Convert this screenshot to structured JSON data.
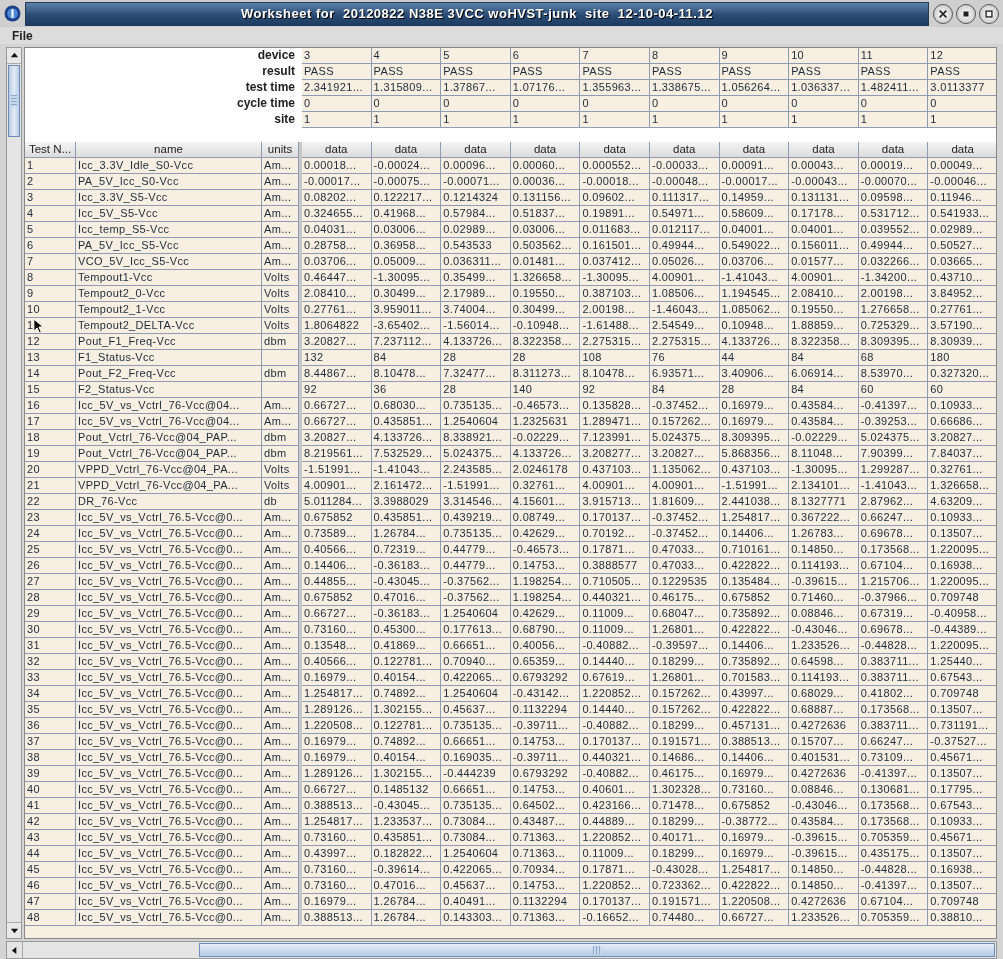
{
  "window": {
    "title": "Worksheet for  20120822 N38E 3VCC woHVST-junk  site  12-10-04-11.12"
  },
  "menu": [
    "File"
  ],
  "summary": {
    "rows": [
      {
        "label": "device",
        "values": [
          "3",
          "4",
          "5",
          "6",
          "7",
          "8",
          "9",
          "10",
          "11",
          "12"
        ]
      },
      {
        "label": "result",
        "values": [
          "PASS",
          "PASS",
          "PASS",
          "PASS",
          "PASS",
          "PASS",
          "PASS",
          "PASS",
          "PASS",
          "PASS"
        ]
      },
      {
        "label": "test time",
        "values": [
          "2.341921...",
          "1.315809...",
          "1.37867...",
          "1.07176...",
          "1.355963...",
          "1.338675...",
          "1.056264...",
          "1.036337...",
          "1.482411...",
          "3.0113377"
        ]
      },
      {
        "label": "cycle time",
        "values": [
          "0",
          "0",
          "0",
          "0",
          "0",
          "0",
          "0",
          "0",
          "0",
          "0"
        ]
      },
      {
        "label": "site",
        "values": [
          "1",
          "1",
          "1",
          "1",
          "1",
          "1",
          "1",
          "1",
          "1",
          "1"
        ]
      }
    ]
  },
  "table": {
    "columns": [
      "Test N...",
      "name",
      "units"
    ],
    "data_columns": [
      "data",
      "data",
      "data",
      "data",
      "data",
      "data",
      "data",
      "data",
      "data",
      "data"
    ],
    "rows": [
      {
        "test": "1",
        "name": "Icc_3.3V_Idle_S0-Vcc",
        "units": "Am...",
        "values": [
          "0.00018...",
          "-0.00024...",
          "0.00096...",
          "0.00060...",
          "0.000552...",
          "-0.00033...",
          "0.00091...",
          "0.00043...",
          "0.00019...",
          "0.00049..."
        ]
      },
      {
        "test": "2",
        "name": "PA_5V_Icc_S0-Vcc",
        "units": "Am...",
        "values": [
          "-0.00017...",
          "-0.00075...",
          "-0.00071...",
          "0.00036...",
          "-0.00018...",
          "-0.00048...",
          "-0.00017...",
          "-0.00043...",
          "-0.00070...",
          "-0.00046..."
        ]
      },
      {
        "test": "3",
        "name": "Icc_3.3V_S5-Vcc",
        "units": "Am...",
        "values": [
          "0.08202...",
          "0.122217...",
          "0.1214324",
          "0.131156...",
          "0.09602...",
          "0.111317...",
          "0.14959...",
          "0.131131...",
          "0.09598...",
          "0.11946..."
        ]
      },
      {
        "test": "4",
        "name": "Icc_5V_S5-Vcc",
        "units": "Am...",
        "values": [
          "0.324655...",
          "0.41968...",
          "0.57984...",
          "0.51837...",
          "0.19891...",
          "0.54971...",
          "0.58609...",
          "0.17178...",
          "0.531712...",
          "0.541933..."
        ]
      },
      {
        "test": "5",
        "name": "Icc_temp_S5-Vcc",
        "units": "Am...",
        "values": [
          "0.04031...",
          "0.03006...",
          "0.02989...",
          "0.03006...",
          "0.011683...",
          "0.012117...",
          "0.04001...",
          "0.04001...",
          "0.039552...",
          "0.02989..."
        ]
      },
      {
        "test": "6",
        "name": "PA_5V_Icc_S5-Vcc",
        "units": "Am...",
        "values": [
          "0.28758...",
          "0.36958...",
          "0.543533",
          "0.503562...",
          "0.161501...",
          "0.49944...",
          "0.549022...",
          "0.156011...",
          "0.49944...",
          "0.50527..."
        ]
      },
      {
        "test": "7",
        "name": "VCO_5V_Icc_S5-Vcc",
        "units": "Am...",
        "values": [
          "0.03706...",
          "0.05009...",
          "0.036311...",
          "0.01481...",
          "0.037412...",
          "0.05026...",
          "0.03706...",
          "0.01577...",
          "0.032266...",
          "0.03665..."
        ]
      },
      {
        "test": "8",
        "name": "Tempout1-Vcc",
        "units": "Volts",
        "values": [
          "0.46447...",
          "-1.30095...",
          "0.35499...",
          "1.326658...",
          "-1.30095...",
          "4.00901...",
          "-1.41043...",
          "4.00901...",
          "-1.34200...",
          "0.43710..."
        ]
      },
      {
        "test": "9",
        "name": "Tempout2_0-Vcc",
        "units": "Volts",
        "values": [
          "2.08410...",
          "0.30499...",
          "2.17989...",
          "0.19550...",
          "0.387103...",
          "1.08506...",
          "1.194545...",
          "2.08410...",
          "2.00198...",
          "3.84952..."
        ]
      },
      {
        "test": "10",
        "name": "Tempout2_1-Vcc",
        "units": "Volts",
        "values": [
          "0.27761...",
          "3.959011...",
          "3.74004...",
          "0.30499...",
          "2.00198...",
          "-1.46043...",
          "1.085062...",
          "0.19550...",
          "1.276658...",
          "0.27761..."
        ]
      },
      {
        "test": "1",
        "name": "Tempout2_DELTA-Vcc",
        "units": "Volts",
        "values": [
          "1.8064822",
          "-3.65402...",
          "-1.56014...",
          "-0.10948...",
          "-1.61488...",
          "2.54549...",
          "0.10948...",
          "1.88859...",
          "0.725329...",
          "3.57190..."
        ]
      },
      {
        "test": "12",
        "name": "Pout_F1_Freq-Vcc",
        "units": "dbm",
        "values": [
          "3.20827...",
          "7.237112...",
          "4.133726...",
          "8.322358...",
          "2.275315...",
          "2.275315...",
          "4.133726...",
          "8.322358...",
          "8.309395...",
          "8.30939..."
        ]
      },
      {
        "test": "13",
        "name": "F1_Status-Vcc",
        "values": [
          "132",
          "84",
          "28",
          "28",
          "108",
          "76",
          "44",
          "84",
          "68",
          "180"
        ]
      },
      {
        "test": "14",
        "name": "Pout_F2_Freq-Vcc",
        "units": "dbm",
        "values": [
          "8.44867...",
          "8.10478...",
          "7.32477...",
          "8.311273...",
          "8.10478...",
          "6.93571...",
          "3.40906...",
          "6.06914...",
          "8.53970...",
          "0.327320..."
        ]
      },
      {
        "test": "15",
        "name": "F2_Status-Vcc",
        "values": [
          "92",
          "36",
          "28",
          "140",
          "92",
          "84",
          "28",
          "84",
          "60",
          "60"
        ]
      },
      {
        "test": "16",
        "name": "Icc_5V_vs_Vctrl_76-Vcc@04...",
        "units": "Am...",
        "values": [
          "0.66727...",
          "0.68030...",
          "0.735135...",
          "-0.46573...",
          "0.135828...",
          "-0.37452...",
          "0.16979...",
          "0.43584...",
          "-0.41397...",
          "0.10933..."
        ]
      },
      {
        "test": "17",
        "name": "Icc_5V_vs_Vctrl_76-Vcc@04...",
        "units": "Am...",
        "values": [
          "0.66727...",
          "0.435851...",
          "1.2540604",
          "1.2325631",
          "1.289471...",
          "0.157262...",
          "0.16979...",
          "0.43584...",
          "-0.39253...",
          "0.66686..."
        ]
      },
      {
        "test": "18",
        "name": "Pout_Vctrl_76-Vcc@04_PAP...",
        "units": "dbm",
        "values": [
          "3.20827...",
          "4.133726...",
          "8.338921...",
          "-0.02229...",
          "7.123991...",
          "5.024375...",
          "8.309395...",
          "-0.02229...",
          "5.024375...",
          "3.20827..."
        ]
      },
      {
        "test": "19",
        "name": "Pout_Vctrl_76-Vcc@04_PAP...",
        "units": "dbm",
        "values": [
          "8.219561...",
          "7.532529...",
          "5.024375...",
          "4.133726...",
          "3.208277...",
          "3.20827...",
          "5.868356...",
          "8.11048...",
          "7.90399...",
          "7.84037..."
        ]
      },
      {
        "test": "20",
        "name": "VPPD_Vctrl_76-Vcc@04_PA...",
        "units": "Volts",
        "values": [
          "-1.51991...",
          "-1.41043...",
          "2.243585...",
          "2.0246178",
          "0.437103...",
          "1.135062...",
          "0.437103...",
          "-1.30095...",
          "1.299287...",
          "0.32761..."
        ]
      },
      {
        "test": "21",
        "name": "VPPD_Vctrl_76-Vcc@04_PA...",
        "units": "Volts",
        "values": [
          "4.00901...",
          "2.161472...",
          "-1.51991...",
          "0.32761...",
          "4.00901...",
          "4.00901...",
          "-1.51991...",
          "2.134101...",
          "-1.41043...",
          "1.326658..."
        ]
      },
      {
        "test": "22",
        "name": "DR_76-Vcc",
        "units": "db",
        "values": [
          "5.011284...",
          "3.3988029",
          "3.314546...",
          "4.15601...",
          "3.915713...",
          "1.81609...",
          "2.441038...",
          "8.1327771",
          "2.87962...",
          "4.63209..."
        ]
      },
      {
        "test": "23",
        "name": "Icc_5V_vs_Vctrl_76.5-Vcc@0...",
        "units": "Am...",
        "values": [
          "0.675852",
          "0.435851...",
          "0.439219...",
          "0.08749...",
          "0.170137...",
          "-0.37452...",
          "1.254817...",
          "0.367222...",
          "0.66247...",
          "0.10933..."
        ]
      },
      {
        "test": "24",
        "name": "Icc_5V_vs_Vctrl_76.5-Vcc@0...",
        "units": "Am...",
        "values": [
          "0.73589...",
          "1.26784...",
          "0.735135...",
          "0.42629...",
          "0.70192...",
          "-0.37452...",
          "0.14406...",
          "1.26783...",
          "0.69678...",
          "0.13507..."
        ]
      },
      {
        "test": "25",
        "name": "Icc_5V_vs_Vctrl_76.5-Vcc@0...",
        "units": "Am...",
        "values": [
          "0.40566...",
          "0.72319...",
          "0.44779...",
          "-0.46573...",
          "0.17871...",
          "0.47033...",
          "0.710161...",
          "0.14850...",
          "0.173568...",
          "1.220095..."
        ]
      },
      {
        "test": "26",
        "name": "Icc_5V_vs_Vctrl_76.5-Vcc@0...",
        "units": "Am...",
        "values": [
          "0.14406...",
          "-0.36183...",
          "0.44779...",
          "0.14753...",
          "0.3888577",
          "0.47033...",
          "0.422822...",
          "0.114193...",
          "0.67104...",
          "0.16938..."
        ]
      },
      {
        "test": "27",
        "name": "Icc_5V_vs_Vctrl_76.5-Vcc@0...",
        "units": "Am...",
        "values": [
          "0.44855...",
          "-0.43045...",
          "-0.37562...",
          "1.198254...",
          "0.710505...",
          "0.1229535",
          "0.135484...",
          "-0.39615...",
          "1.215706...",
          "1.220095..."
        ]
      },
      {
        "test": "28",
        "name": "Icc_5V_vs_Vctrl_76.5-Vcc@0...",
        "units": "Am...",
        "values": [
          "0.675852",
          "0.47016...",
          "-0.37562...",
          "1.198254...",
          "0.440321...",
          "0.46175...",
          "0.675852",
          "0.71460...",
          "-0.37966...",
          "0.709748"
        ]
      },
      {
        "test": "29",
        "name": "Icc_5V_vs_Vctrl_76.5-Vcc@0...",
        "units": "Am...",
        "values": [
          "0.66727...",
          "-0.36183...",
          "1.2540604",
          "0.42629...",
          "0.11009...",
          "0.68047...",
          "0.735892...",
          "0.08846...",
          "0.67319...",
          "-0.40958..."
        ]
      },
      {
        "test": "30",
        "name": "Icc_5V_vs_Vctrl_76.5-Vcc@0...",
        "units": "Am...",
        "values": [
          "0.73160...",
          "0.45300...",
          "0.177613...",
          "0.68790...",
          "0.11009...",
          "1.26801...",
          "0.422822...",
          "-0.43046...",
          "0.69678...",
          "-0.44389..."
        ]
      },
      {
        "test": "31",
        "name": "Icc_5V_vs_Vctrl_76.5-Vcc@0...",
        "units": "Am...",
        "values": [
          "0.13548...",
          "0.41869...",
          "0.66651...",
          "0.40056...",
          "-0.40882...",
          "-0.39597...",
          "0.14406...",
          "1.233526...",
          "-0.44828...",
          "1.220095..."
        ]
      },
      {
        "test": "32",
        "name": "Icc_5V_vs_Vctrl_76.5-Vcc@0...",
        "units": "Am...",
        "values": [
          "0.40566...",
          "0.122781...",
          "0.70940...",
          "0.65359...",
          "0.14440...",
          "0.18299...",
          "0.735892...",
          "0.64598...",
          "0.383711...",
          "1.25440..."
        ]
      },
      {
        "test": "33",
        "name": "Icc_5V_vs_Vctrl_76.5-Vcc@0...",
        "units": "Am...",
        "values": [
          "0.16979...",
          "0.40154...",
          "0.422065...",
          "0.6793292",
          "0.67619...",
          "1.26801...",
          "0.701583...",
          "0.114193...",
          "0.383711...",
          "0.67543..."
        ]
      },
      {
        "test": "34",
        "name": "Icc_5V_vs_Vctrl_76.5-Vcc@0...",
        "units": "Am...",
        "values": [
          "1.254817...",
          "0.74892...",
          "1.2540604",
          "-0.43142...",
          "1.220852...",
          "0.157262...",
          "0.43997...",
          "0.68029...",
          "0.41802...",
          "0.709748"
        ]
      },
      {
        "test": "35",
        "name": "Icc_5V_vs_Vctrl_76.5-Vcc@0...",
        "units": "Am...",
        "values": [
          "1.289126...",
          "1.302155...",
          "0.45637...",
          "0.1132294",
          "0.14440...",
          "0.157262...",
          "0.422822...",
          "0.68887...",
          "0.173568...",
          "0.13507..."
        ]
      },
      {
        "test": "36",
        "name": "Icc_5V_vs_Vctrl_76.5-Vcc@0...",
        "units": "Am...",
        "values": [
          "1.220508...",
          "0.122781...",
          "0.735135...",
          "-0.39711...",
          "-0.40882...",
          "0.18299...",
          "0.457131...",
          "0.4272636",
          "0.383711...",
          "0.731191..."
        ]
      },
      {
        "test": "37",
        "name": "Icc_5V_vs_Vctrl_76.5-Vcc@0...",
        "units": "Am...",
        "values": [
          "0.16979...",
          "0.74892...",
          "0.66651...",
          "0.14753...",
          "0.170137...",
          "0.191571...",
          "0.388513...",
          "0.15707...",
          "0.66247...",
          "-0.37527..."
        ]
      },
      {
        "test": "38",
        "name": "Icc_5V_vs_Vctrl_76.5-Vcc@0...",
        "units": "Am...",
        "values": [
          "0.16979...",
          "0.40154...",
          "0.169035...",
          "-0.39711...",
          "0.440321...",
          "0.14686...",
          "0.14406...",
          "0.401531...",
          "0.73109...",
          "0.45671..."
        ]
      },
      {
        "test": "39",
        "name": "Icc_5V_vs_Vctrl_76.5-Vcc@0...",
        "units": "Am...",
        "values": [
          "1.289126...",
          "1.302155...",
          "-0.444239",
          "0.6793292",
          "-0.40882...",
          "0.46175...",
          "0.16979...",
          "0.4272636",
          "-0.41397...",
          "0.13507..."
        ]
      },
      {
        "test": "40",
        "name": "Icc_5V_vs_Vctrl_76.5-Vcc@0...",
        "units": "Am...",
        "values": [
          "0.66727...",
          "0.1485132",
          "0.66651...",
          "0.14753...",
          "0.40601...",
          "1.302328...",
          "0.73160...",
          "0.08846...",
          "0.130681...",
          "0.17795..."
        ]
      },
      {
        "test": "41",
        "name": "Icc_5V_vs_Vctrl_76.5-Vcc@0...",
        "units": "Am...",
        "values": [
          "0.388513...",
          "-0.43045...",
          "0.735135...",
          "0.64502...",
          "0.423166...",
          "0.71478...",
          "0.675852",
          "-0.43046...",
          "0.173568...",
          "0.67543..."
        ]
      },
      {
        "test": "42",
        "name": "Icc_5V_vs_Vctrl_76.5-Vcc@0...",
        "units": "Am...",
        "values": [
          "1.254817...",
          "1.233537...",
          "0.73084...",
          "0.43487...",
          "0.44889...",
          "0.18299...",
          "-0.38772...",
          "0.43584...",
          "0.173568...",
          "0.10933..."
        ]
      },
      {
        "test": "43",
        "name": "Icc_5V_vs_Vctrl_76.5-Vcc@0...",
        "units": "Am...",
        "values": [
          "0.73160...",
          "0.435851...",
          "0.73084...",
          "0.71363...",
          "1.220852...",
          "0.40171...",
          "0.16979...",
          "-0.39615...",
          "0.705359...",
          "0.45671..."
        ]
      },
      {
        "test": "44",
        "name": "Icc_5V_vs_Vctrl_76.5-Vcc@0...",
        "units": "Am...",
        "values": [
          "0.43997...",
          "0.182822...",
          "1.2540604",
          "0.71363...",
          "0.11009...",
          "0.18299...",
          "0.16979...",
          "-0.39615...",
          "0.435175...",
          "0.13507..."
        ]
      },
      {
        "test": "45",
        "name": "Icc_5V_vs_Vctrl_76.5-Vcc@0...",
        "units": "Am...",
        "values": [
          "0.73160...",
          "-0.39614...",
          "0.422065...",
          "0.70934...",
          "0.17871...",
          "-0.43028...",
          "1.254817...",
          "0.14850...",
          "-0.44828...",
          "0.16938..."
        ]
      },
      {
        "test": "46",
        "name": "Icc_5V_vs_Vctrl_76.5-Vcc@0...",
        "units": "Am...",
        "values": [
          "0.73160...",
          "0.47016...",
          "0.45637...",
          "0.14753...",
          "1.220852...",
          "0.723362...",
          "0.422822...",
          "0.14850...",
          "-0.41397...",
          "0.13507..."
        ]
      },
      {
        "test": "47",
        "name": "Icc_5V_vs_Vctrl_76.5-Vcc@0...",
        "units": "Am...",
        "values": [
          "0.16979...",
          "1.26784...",
          "0.40491...",
          "0.1132294",
          "0.170137...",
          "0.191571...",
          "1.220508...",
          "0.4272636",
          "0.67104...",
          "0.709748"
        ]
      },
      {
        "test": "48",
        "name": "Icc_5V_vs_Vctrl_76.5-Vcc@0...",
        "units": "Am...",
        "values": [
          "0.388513...",
          "1.26784...",
          "0.143303...",
          "0.71363...",
          "-0.16652...",
          "0.74480...",
          "0.66727...",
          "1.233526...",
          "0.705359...",
          "0.38810..."
        ]
      }
    ]
  }
}
